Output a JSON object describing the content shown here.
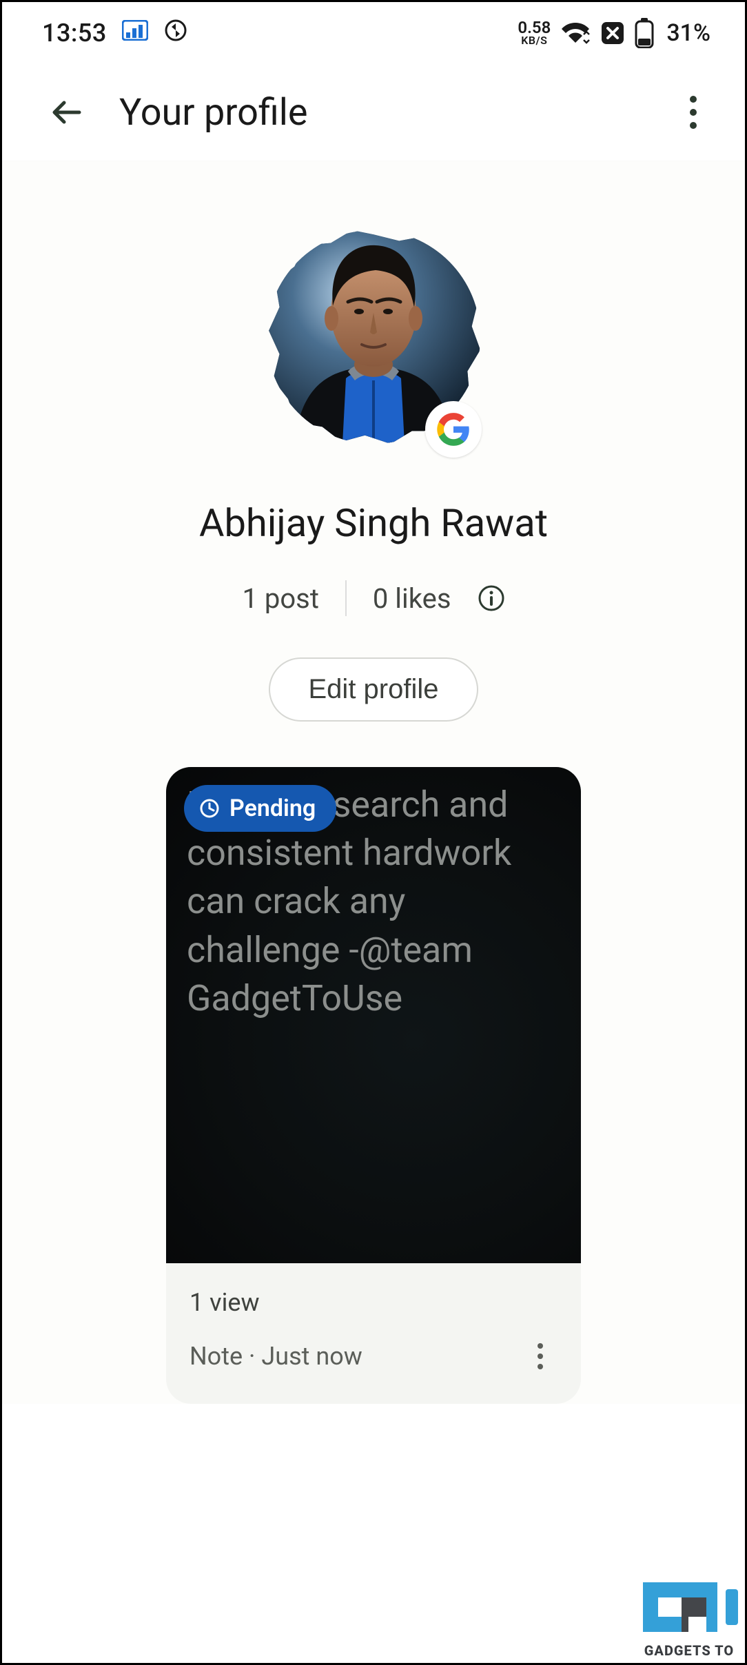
{
  "status_bar": {
    "time": "13:53",
    "network_speed_value": "0.58",
    "network_speed_unit": "KB/S",
    "battery_percent": "31%"
  },
  "app_bar": {
    "title": "Your profile"
  },
  "profile": {
    "name": "Abhijay Singh Rawat",
    "posts_label": "1 post",
    "likes_label": "0 likes",
    "edit_label": "Edit profile"
  },
  "post": {
    "pending_label": "Pending",
    "body": "Proper research and consistent hardwork can crack any challenge -@team GadgetToUse",
    "views_label": "1 view",
    "type_label": "Note",
    "time_label": "Just now"
  },
  "watermark": {
    "text": "GADGETS TO"
  }
}
